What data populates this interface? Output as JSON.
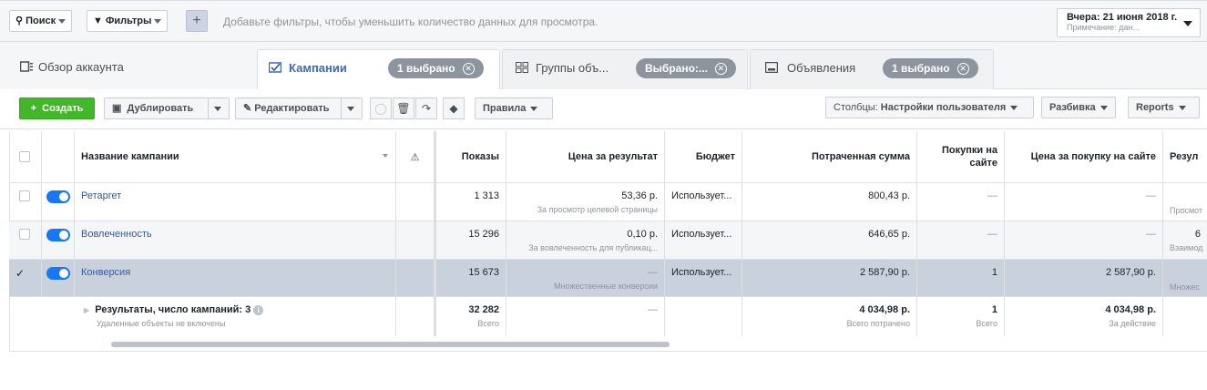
{
  "filterbar": {
    "search_label": "Поиск",
    "filters_label": "Фильтры",
    "add_label": "+",
    "hint": "Добавьте фильтры, чтобы уменьшить количество данных для просмотра.",
    "date_label": "Вчера: 21 июня 2018 г.",
    "date_note": "Примечание: дан..."
  },
  "tabs": [
    {
      "label": "Обзор аккаунта",
      "icon": "account-overview-icon"
    },
    {
      "label": "Кампании",
      "icon": "campaign-check-icon",
      "badge": "1 выбрано",
      "active": true
    },
    {
      "label": "Группы объ...",
      "icon": "grid-icon",
      "badge": "Выбрано:..."
    },
    {
      "label": "Объявления",
      "icon": "ad-icon",
      "badge": "1 выбрано"
    }
  ],
  "toolbar": {
    "create_label": "Создать",
    "duplicate_label": "Дублировать",
    "edit_label": "Редактировать",
    "rules_label": "Правила",
    "columns_prefix": "Столбцы:",
    "columns_value": "Настройки пользователя",
    "breakdown_label": "Разбивка",
    "reports_label": "Reports"
  },
  "table": {
    "headers": {
      "name": "Название кампании",
      "impressions": "Показы",
      "cost_per_result": "Цена за результат",
      "budget": "Бюджет",
      "amount_spent": "Потраченная сумма",
      "purchases_line1": "Покупки на",
      "purchases_line2": "сайте",
      "cost_per_purchase": "Цена за покупку на сайте",
      "results": "Резул"
    },
    "rows": [
      {
        "name": "Ретаргет",
        "impressions": "1 313",
        "cpr": "53,36 р.",
        "cpr_sub": "За просмотр целевой страницы",
        "budget": "Использует...",
        "spent": "800,43 р.",
        "purchases": "—",
        "cpp": "—",
        "results_sub": "Просмот"
      },
      {
        "name": "Вовлеченность",
        "impressions": "15 296",
        "cpr": "0,10 р.",
        "cpr_sub": "За вовлеченность для публикац...",
        "budget": "Использует...",
        "spent": "646,65 р.",
        "purchases": "—",
        "cpp": "—",
        "results": "6",
        "results_sub": "Взаимод"
      },
      {
        "name": "Конверсия",
        "impressions": "15 673",
        "cpr": "—",
        "cpr_sub": "Множественные конверсии",
        "budget": "Использует...",
        "spent": "2 587,90 р.",
        "purchases": "1",
        "cpp": "2 587,90 р.",
        "results_sub": "Множес"
      }
    ],
    "summary": {
      "title": "Результаты, число кампаний: 3",
      "subtitle": "Удаленные объекты не включены",
      "impressions": "32 282",
      "impressions_sub": "Всего",
      "cpr": "—",
      "spent": "4 034,98 р.",
      "spent_sub": "Всего потрачено",
      "purchases": "1",
      "purchases_sub": "Всего",
      "cpp": "4 034,98 р.",
      "cpp_sub": "За действие"
    }
  }
}
